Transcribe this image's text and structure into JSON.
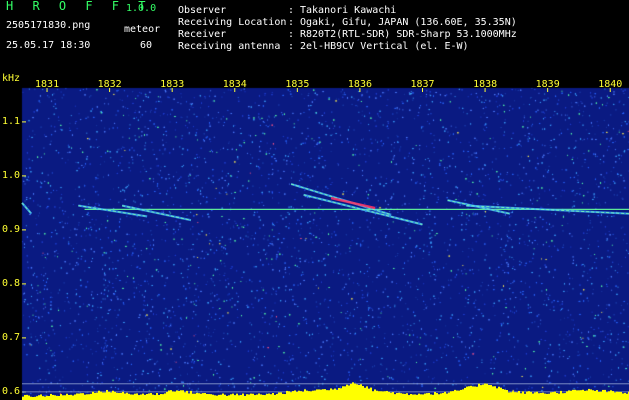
{
  "header": {
    "title": "H R O F F T",
    "version": "1.0.0",
    "filename": "2505171830.png",
    "datetime": "25.05.17 18:30",
    "meteor_label": "meteor",
    "meteor_count": "60",
    "info": [
      {
        "key": "Observer",
        "value": "Takanori Kawachi"
      },
      {
        "key": "Receiving Location",
        "value": "Ogaki, Gifu, JAPAN (136.60E, 35.35N)"
      },
      {
        "key": "Receiver",
        "value": "R820T2(RTL-SDR) SDR-Sharp 53.1000MHz"
      },
      {
        "key": "Receiving antenna",
        "value": "2el-HB9CV Vertical (el. E-W)"
      }
    ]
  },
  "colors": {
    "background": "#000000",
    "plot_background": "#0a1a82",
    "axis_text": "#ffff33",
    "header_green": "#33ff66",
    "carrier": "#66ff99",
    "echo_core": "#ff3366",
    "power_bars": "#ffff00"
  },
  "chart_data": {
    "type": "heatmap",
    "title": "",
    "ylabel": "kHz",
    "xlim": [
      1830.6,
      1840.3
    ],
    "ylim": [
      0.585,
      1.185
    ],
    "x_ticks": [
      {
        "value": 1831,
        "label": "1831"
      },
      {
        "value": 1832,
        "label": "1832"
      },
      {
        "value": 1833,
        "label": "1833"
      },
      {
        "value": 1834,
        "label": "1834"
      },
      {
        "value": 1835,
        "label": "1835"
      },
      {
        "value": 1836,
        "label": "1836"
      },
      {
        "value": 1837,
        "label": "1837"
      },
      {
        "value": 1838,
        "label": "1838"
      },
      {
        "value": 1839,
        "label": "1839"
      },
      {
        "value": 1840,
        "label": "1840"
      }
    ],
    "y_ticks": [
      {
        "value": 1.1,
        "label": "1.1"
      },
      {
        "value": 1.0,
        "label": "1.0"
      },
      {
        "value": 0.9,
        "label": "0.9"
      },
      {
        "value": 0.8,
        "label": "0.8"
      },
      {
        "value": 0.7,
        "label": "0.7"
      },
      {
        "value": 0.6,
        "label": "0.6"
      }
    ],
    "grid": false,
    "carrier_freq_khz": 0.938,
    "echo_traces": [
      {
        "x": [
          1831.5,
          1832.6
        ],
        "y": [
          0.945,
          0.925
        ],
        "intensity": 0.5
      },
      {
        "x": [
          1832.2,
          1833.3
        ],
        "y": [
          0.945,
          0.918
        ],
        "intensity": 0.5
      },
      {
        "x": [
          1834.9,
          1836.5
        ],
        "y": [
          0.985,
          0.928
        ],
        "intensity": 0.9
      },
      {
        "x": [
          1835.1,
          1837.0
        ],
        "y": [
          0.965,
          0.91
        ],
        "intensity": 0.6
      },
      {
        "x": [
          1837.4,
          1838.4
        ],
        "y": [
          0.955,
          0.93
        ],
        "intensity": 0.6
      },
      {
        "x": [
          1837.7,
          1840.3
        ],
        "y": [
          0.945,
          0.93
        ],
        "intensity": 0.6
      },
      {
        "x": [
          1830.6,
          1830.75
        ],
        "y": [
          0.95,
          0.93
        ],
        "intensity": 0.7
      }
    ],
    "power_profile": [
      {
        "x": 1830.6,
        "level": 0.2
      },
      {
        "x": 1831.3,
        "level": 0.25
      },
      {
        "x": 1832.0,
        "level": 0.45
      },
      {
        "x": 1832.3,
        "level": 0.3
      },
      {
        "x": 1832.8,
        "level": 0.3
      },
      {
        "x": 1833.0,
        "level": 0.5
      },
      {
        "x": 1833.5,
        "level": 0.3
      },
      {
        "x": 1834.0,
        "level": 0.25
      },
      {
        "x": 1834.6,
        "level": 0.3
      },
      {
        "x": 1835.0,
        "level": 0.45
      },
      {
        "x": 1835.6,
        "level": 0.55
      },
      {
        "x": 1835.9,
        "level": 0.9
      },
      {
        "x": 1836.2,
        "level": 0.5
      },
      {
        "x": 1836.7,
        "level": 0.3
      },
      {
        "x": 1837.4,
        "level": 0.35
      },
      {
        "x": 1838.0,
        "level": 0.85
      },
      {
        "x": 1838.4,
        "level": 0.4
      },
      {
        "x": 1839.0,
        "level": 0.35
      },
      {
        "x": 1839.6,
        "level": 0.5
      },
      {
        "x": 1840.3,
        "level": 0.35
      }
    ]
  }
}
